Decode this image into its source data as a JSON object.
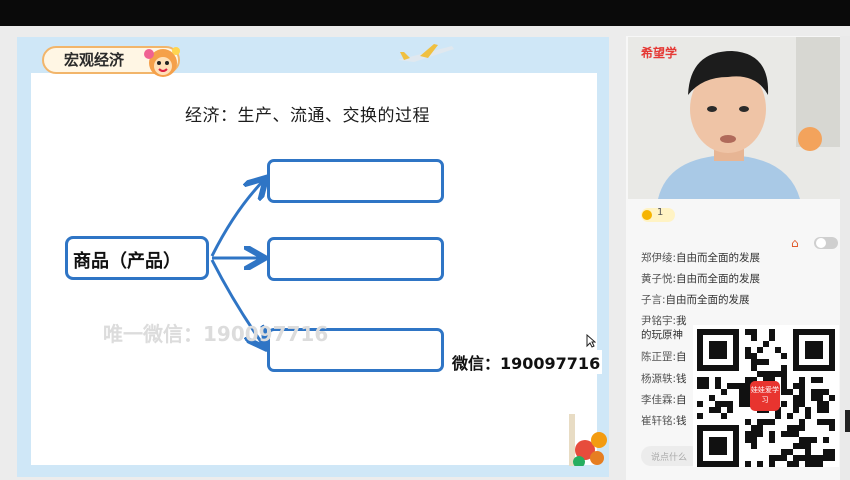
{
  "slide": {
    "tag_title": "宏观经济",
    "heading": "经济：生产、流通、交换的过程",
    "source_label": "商品（产品）",
    "target_boxes": [
      "",
      "",
      ""
    ],
    "watermark": "唯一微信：190097716",
    "contact": "微信：190097716"
  },
  "sidebar": {
    "logo": "希望学",
    "likes": "1",
    "input_placeholder": "说点什么",
    "chat": [
      {
        "user": "郑伊绫:",
        "text": "自由而全面的发展"
      },
      {
        "user": "黄子悦:",
        "text": "自由而全面的发展"
      },
      {
        "user": "子言:",
        "text": "自由而全面的发展"
      },
      {
        "user": "尹铭宇:",
        "text": "我"
      },
      {
        "user": "",
        "text": "的玩原神"
      },
      {
        "user": "陈正罡:",
        "text": "自"
      },
      {
        "user": "杨源轶:",
        "text": "钱"
      },
      {
        "user": "李佳霖:",
        "text": "自"
      },
      {
        "user": "崔轩铭:",
        "text": "钱"
      }
    ],
    "qr_badge": "娃娃爱学习"
  },
  "colors": {
    "accent": "#2f75c5",
    "slide_bg": "#cfe7f7",
    "brand": "#e53935"
  }
}
